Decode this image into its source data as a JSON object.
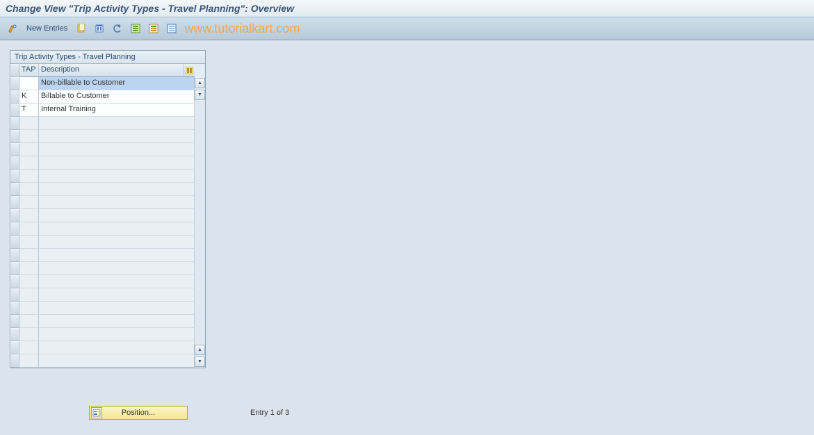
{
  "title": "Change View \"Trip Activity Types - Travel Planning\": Overview",
  "toolbar": {
    "new_entries": "New Entries"
  },
  "watermark": "www.tutorialkart.com",
  "table": {
    "title": "Trip Activity Types - Travel Planning",
    "columns": {
      "tap": "TAP",
      "desc": "Description"
    },
    "rows": [
      {
        "tap": "",
        "desc": "Non-billable to Customer",
        "selected": true
      },
      {
        "tap": "K",
        "desc": "Billable to Customer",
        "selected": false
      },
      {
        "tap": "T",
        "desc": "Internal Training",
        "selected": false
      }
    ],
    "empty_rows": 19
  },
  "footer": {
    "position_label": "Position...",
    "entry_text": "Entry 1 of 3"
  }
}
